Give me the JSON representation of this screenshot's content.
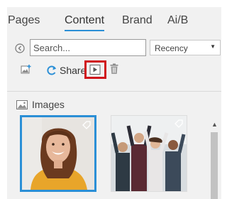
{
  "tabs": [
    {
      "label": "Pages",
      "active": false
    },
    {
      "label": "Content",
      "active": true
    },
    {
      "label": "Brand",
      "active": false
    },
    {
      "label": "Ai/B",
      "active": false
    }
  ],
  "search": {
    "value": "",
    "placeholder": "Search..."
  },
  "sort": {
    "selected": "Recency"
  },
  "toolbar": {
    "share_label": "Share"
  },
  "section": {
    "title": "Images"
  },
  "thumbnails": [
    {
      "alt": "Woman smiling portrait",
      "selected": true
    },
    {
      "alt": "Team celebrating",
      "selected": false
    }
  ],
  "colors": {
    "accent": "#2b8fd6",
    "highlight": "#d0151c",
    "panel": "#f1f1f1"
  }
}
